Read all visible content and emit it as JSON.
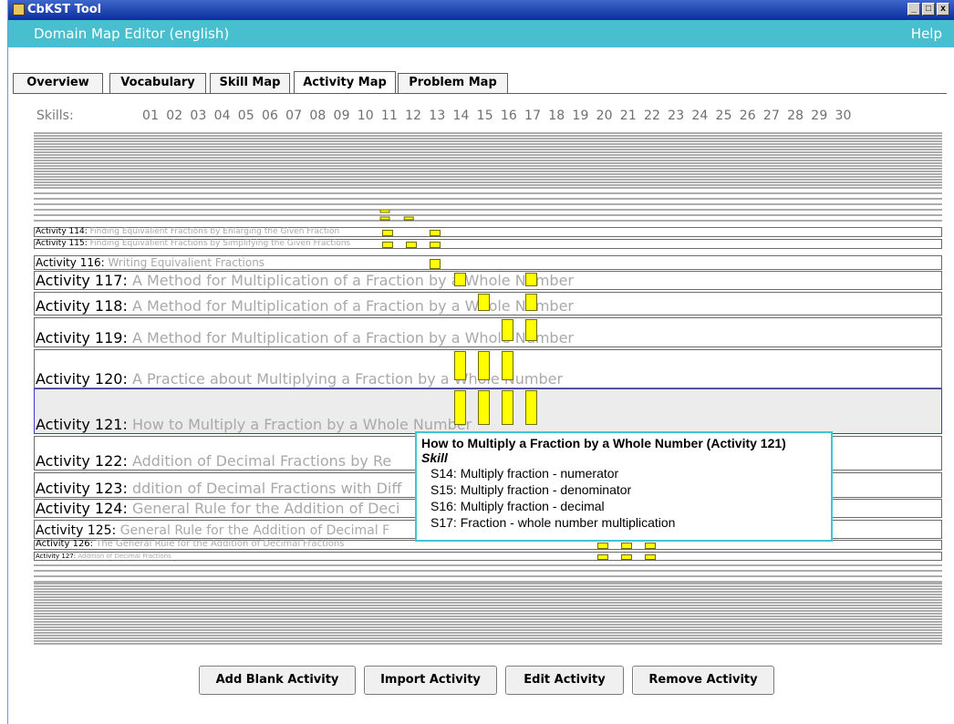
{
  "window": {
    "app_title": "CbKST Tool",
    "controls": [
      "_",
      "□",
      "x"
    ]
  },
  "menubar": {
    "editor_title": "Domain Map Editor (english)",
    "help": "Help"
  },
  "tabs": [
    {
      "label": "Overview",
      "active": false
    },
    {
      "label": "Vocabulary",
      "active": false
    },
    {
      "label": "Skill Map",
      "active": false
    },
    {
      "label": "Activity Map",
      "active": true
    },
    {
      "label": "Problem Map",
      "active": false
    }
  ],
  "skills_header": {
    "label": "Skills:",
    "numbers": [
      "01",
      "02",
      "03",
      "04",
      "05",
      "06",
      "07",
      "08",
      "09",
      "10",
      "11",
      "12",
      "13",
      "14",
      "15",
      "16",
      "17",
      "18",
      "19",
      "20",
      "21",
      "22",
      "23",
      "24",
      "25",
      "26",
      "27",
      "28",
      "29",
      "30"
    ]
  },
  "activities": [
    {
      "id": "Activity 114",
      "sep": ":",
      "desc": " Finding Equivalient Fractions by Enlarging the Given Fraction",
      "skills": [
        11,
        13
      ]
    },
    {
      "id": "Activity 115",
      "sep": ":",
      "desc": " Finding Equivalient Fractions by Simplifying the Given Fractions",
      "skills": [
        11,
        12,
        13
      ]
    },
    {
      "id": "Activity 116",
      "sep": ":",
      "desc": " Writing Equivalient Fractions",
      "skills": [
        13
      ]
    },
    {
      "id": "Activity 117",
      "sep": ":",
      "desc": " A Method for Multiplication of a Fraction by a Whole Number",
      "skills": [
        14,
        17
      ]
    },
    {
      "id": "Activity 118",
      "sep": ":",
      "desc": " A Method for Multiplication of a Fraction by a Whole Number",
      "skills": [
        15,
        17
      ]
    },
    {
      "id": "Activity 119",
      "sep": ":",
      "desc": " A Method for Multiplication of a Fraction by a Whole Number",
      "skills": [
        16,
        17
      ]
    },
    {
      "id": "Activity 120",
      "sep": ":",
      "desc": " A Practice about Multiplying a Fraction by a Whole Number",
      "skills": [
        14,
        15,
        16
      ]
    },
    {
      "id": "Activity 121",
      "sep": ":",
      "desc": " How to Multiply a Fraction by a Whole Number",
      "skills": [
        14,
        15,
        16,
        17
      ],
      "selected": true
    },
    {
      "id": "Activity 122",
      "sep": ":",
      "desc": " Addition of Decimal Fractions by Re",
      "skills": []
    },
    {
      "id": "Activity 123",
      "sep": ":",
      "desc": " ddition of Decimal Fractions with Diff",
      "skills": []
    },
    {
      "id": "Activity 124",
      "sep": ":",
      "desc": " General Rule for the Addition of Deci",
      "skills": []
    },
    {
      "id": "Activity 125",
      "sep": ":",
      "desc": " General Rule for the Addition of Decimal F",
      "skills": []
    },
    {
      "id": "Activity 126",
      "sep": ":",
      "desc": " The General Rule for the Addition of Decimal Fractions",
      "skills": [
        20,
        21,
        22
      ]
    },
    {
      "id": "Activity 127",
      "sep": ":",
      "desc": " Addition of Decimal Fractions",
      "skills": [
        20,
        21,
        22
      ]
    }
  ],
  "tooltip": {
    "title": "How to Multiply a Fraction by a Whole Number   (Activity 121)",
    "heading": "Skill",
    "items": [
      "S14: Multiply fraction - numerator",
      "S15: Multiply fraction - denominator",
      "S16: Multiply fraction - decimal",
      "S17: Fraction - whole number multiplication"
    ]
  },
  "buttons": {
    "add_blank": "Add Blank Activity",
    "import": "Import Activity",
    "edit": "Edit Activity",
    "remove": "Remove Activity"
  },
  "colors": {
    "menubar": "#47bfcf",
    "titlebar": "#0a2f9e",
    "skill_bar": "#ffff00",
    "selected_row_border": "#3b3bd1",
    "tooltip_border": "#3ec7d3"
  }
}
